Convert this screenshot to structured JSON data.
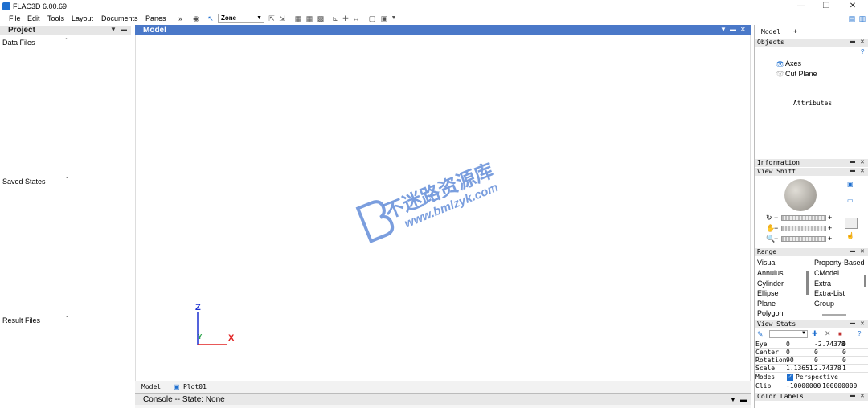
{
  "window": {
    "title": "FLAC3D 6.00.69"
  },
  "menu": [
    "File",
    "Edit",
    "Tools",
    "Layout",
    "Documents",
    "Panes"
  ],
  "toolbar": {
    "overflow": "»",
    "zone_select": "Zone"
  },
  "project": {
    "title": "Project",
    "sections": [
      "Data Files",
      "Saved States",
      "Result Files"
    ]
  },
  "model": {
    "title": "Model",
    "tabs": [
      "Model",
      "Plot01"
    ],
    "axes": {
      "z": "Z",
      "x": "X",
      "y": "Y"
    },
    "watermark": {
      "main": "不迷路资源库",
      "url": "www.bmlzyk.com"
    }
  },
  "console": {
    "title": "Console -- State: None"
  },
  "right": {
    "tabs": [
      "Model",
      "+"
    ],
    "objects": {
      "title": "Objects",
      "help": "?",
      "items": [
        "Axes",
        "Cut Plane"
      ],
      "attributes_label": "Attributes"
    },
    "information": {
      "title": "Information"
    },
    "view_shift": {
      "title": "View Shift"
    },
    "range": {
      "title": "Range",
      "left": [
        "Visual",
        "Annulus",
        "Cylinder",
        "Ellipse",
        "Plane",
        "Polygon"
      ],
      "right": [
        "Property-Based",
        "CModel",
        "Extra",
        "Extra-List",
        "Group"
      ]
    },
    "view_stats": {
      "title": "View Stats",
      "help": "?",
      "rows": [
        {
          "label": "Eye",
          "v1": "0",
          "v2": "-2.74378",
          "v3": "0"
        },
        {
          "label": "Center",
          "v1": "0",
          "v2": "0",
          "v3": "0"
        },
        {
          "label": "Rotation",
          "v1": "90",
          "v2": "0",
          "v3": "0"
        },
        {
          "label": "Scale",
          "v1": "1.13651",
          "v2": "2.74378",
          "v3": "1"
        }
      ],
      "modes_label": "Modes",
      "perspective": "Perspective",
      "clip_label": "Clip",
      "clip_min": "-10000000",
      "clip_max": "100000000"
    },
    "color_labels": {
      "title": "Color Labels"
    }
  },
  "colors": {
    "accent": "#4a78c8",
    "z_axis": "#1a2fd0",
    "x_axis": "#e02020",
    "y_axis": "#20a040"
  }
}
